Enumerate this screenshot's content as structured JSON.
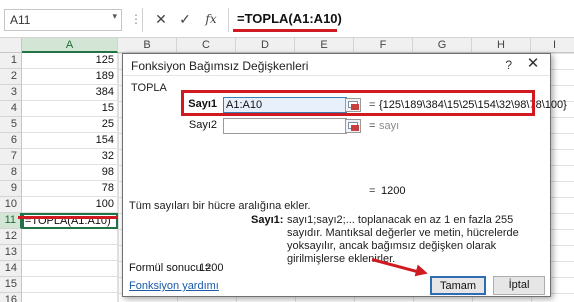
{
  "formula_bar": {
    "name_box": "A11",
    "name_arrow": "▾",
    "cancel_glyph": "✕",
    "enter_glyph": "✓",
    "fx_glyph": "fx",
    "formula": "=TOPLA(A1:A10)"
  },
  "columns": [
    "A",
    "B",
    "C",
    "D",
    "E",
    "F",
    "G",
    "H",
    "I"
  ],
  "rows": [
    "1",
    "2",
    "3",
    "4",
    "5",
    "6",
    "7",
    "8",
    "9",
    "10",
    "11",
    "12",
    "13",
    "14",
    "15",
    "16"
  ],
  "cells_a": [
    "125",
    "189",
    "384",
    "15",
    "25",
    "154",
    "32",
    "98",
    "78",
    "100",
    "=TOPLA(A1:A10)"
  ],
  "dialog": {
    "title": "Fonksiyon Bağımsız Değişkenleri",
    "help": "?",
    "close": "✕",
    "function_name": "TOPLA",
    "arg1_label": "Sayı1",
    "arg1_value": "A1:A10",
    "arg1_result": "{125\\189\\384\\15\\25\\154\\32\\98\\78\\100}",
    "arg2_label": "Sayı2",
    "arg2_value": "",
    "arg2_result": "sayı",
    "eq": "=",
    "total": "1200",
    "description": "Tüm sayıları bir hücre aralığına ekler.",
    "arg_desc_name": "Sayı1:",
    "arg_desc_text": "sayı1;sayı2;... toplanacak en az 1 en fazla 255 sayıdır. Mantıksal değerler ve metin, hücrelerde yoksayılır, ancak bağımsız değişken olarak girilmişlerse eklenirler.",
    "result_label": "Formül sonucu =",
    "result_value": "1200",
    "help_link": "Fonksiyon yardımı",
    "ok": "Tamam",
    "cancel": "İptal"
  },
  "colors": {
    "annotation_red": "#d01a22",
    "excel_green": "#217346",
    "link_blue": "#1a5aa8"
  }
}
